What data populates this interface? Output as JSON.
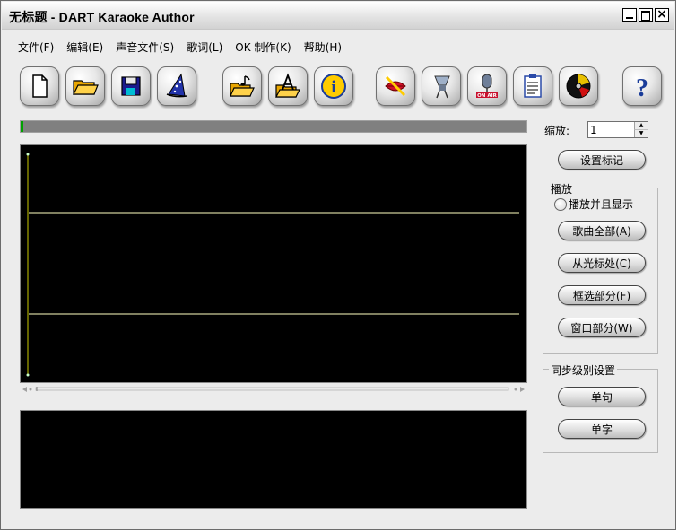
{
  "window": {
    "title": "无标题 - DART Karaoke Author",
    "close_glyph": "×"
  },
  "menu": [
    {
      "label": "文件(F)"
    },
    {
      "label": "编辑(E)"
    },
    {
      "label": "声音文件(S)"
    },
    {
      "label": "歌词(L)"
    },
    {
      "label": "OK 制作(K)"
    },
    {
      "label": "帮助(H)"
    }
  ],
  "toolbar": {
    "new_icon": "new-document-icon",
    "open_icon": "open-folder-icon",
    "save_icon": "save-disk-icon",
    "wizard_icon": "wizard-hat-icon",
    "open_audio_icon": "open-audio-icon",
    "open_lyrics_icon": "open-lyrics-icon",
    "info_icon": "info-icon",
    "mute_voice_icon": "no-lips-icon",
    "mixer_icon": "mixer-icon",
    "on_air_icon": "on-air-microphone-icon",
    "notes_icon": "clipboard-icon",
    "cd_icon": "cd-disc-icon",
    "help_icon": "help-icon",
    "on_air_text": "ON AIR",
    "help_text": "?",
    "info_text": "i"
  },
  "zoom": {
    "label": "缩放:",
    "value": "1"
  },
  "buttons": {
    "set_marker": "设置标记",
    "song_all": "歌曲全部(A)",
    "from_cursor": "从光标处(C)",
    "selection": "框选部分(F)",
    "window_part": "窗口部分(W)",
    "single_line": "单句",
    "single_char": "单字"
  },
  "playback": {
    "title": "播放",
    "play_and_show": "播放并且显示",
    "play_and_show_checked": false
  },
  "sync": {
    "title": "同步级别设置"
  },
  "colors": {
    "waveform_bg": "#000000",
    "waveform_line": "#ffffc0",
    "cursor_line": "#c8c800",
    "progress_fill": "#808080"
  }
}
